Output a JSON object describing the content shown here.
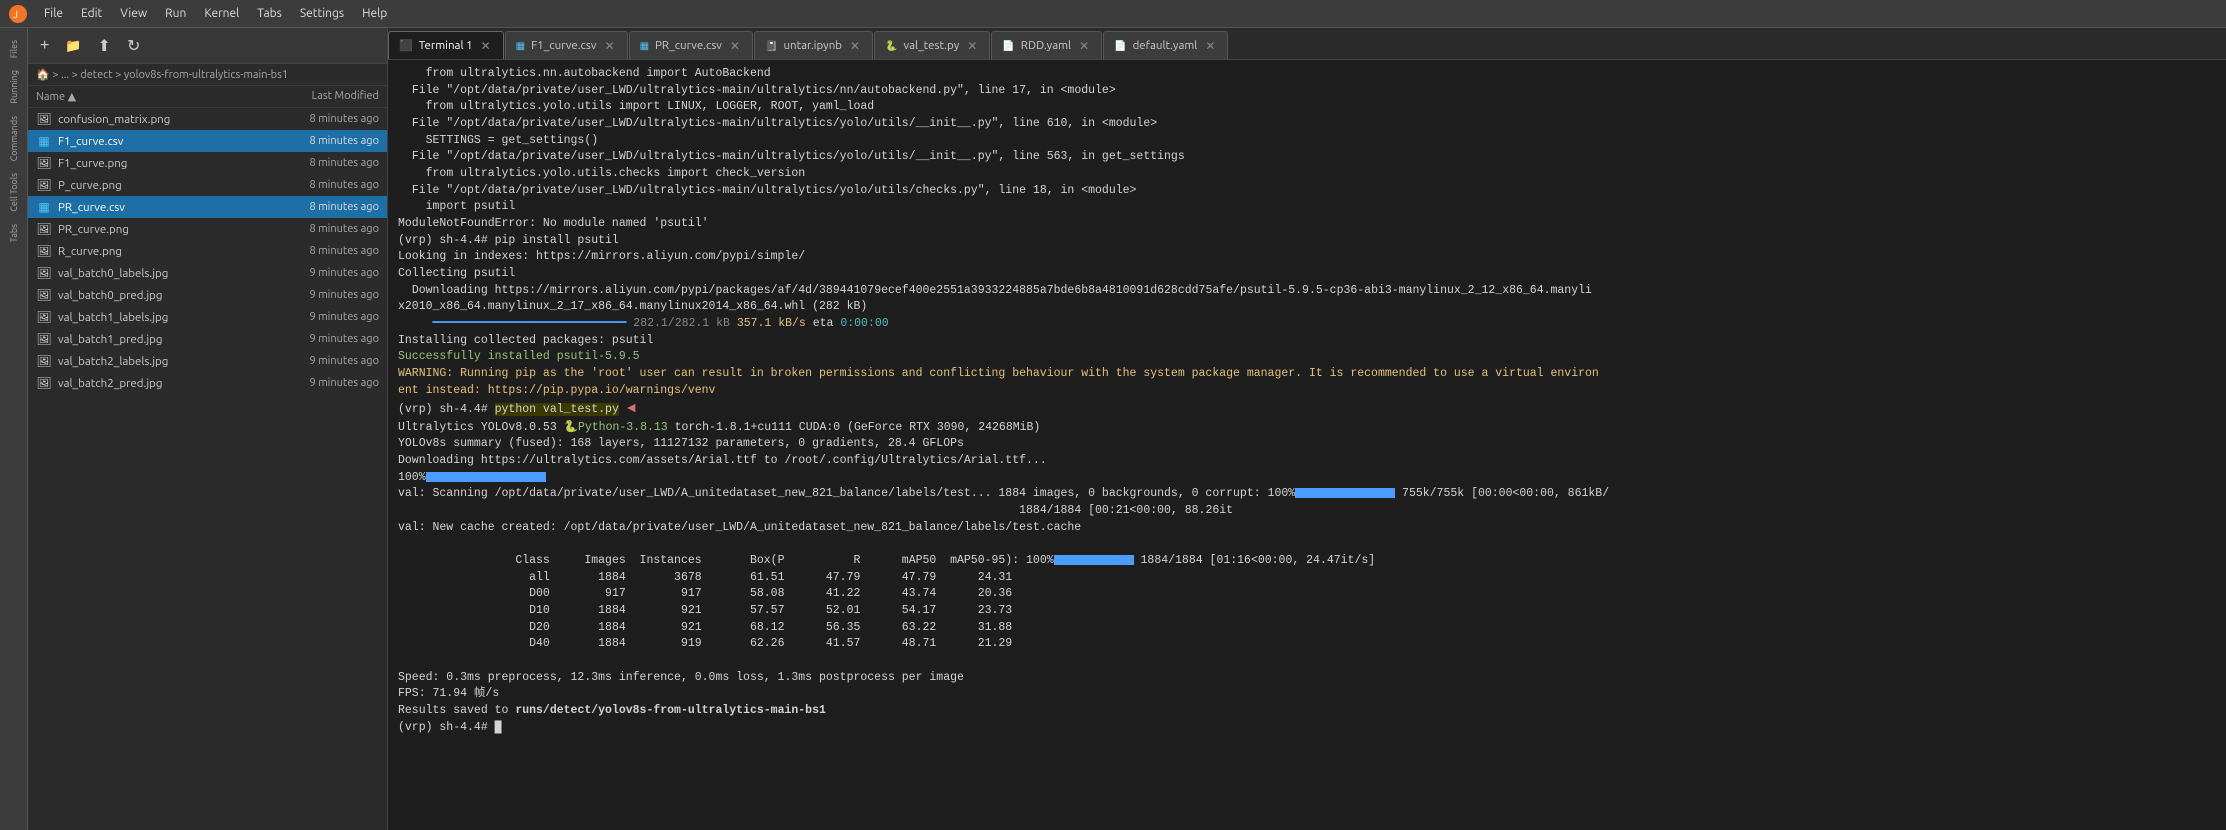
{
  "menubar": {
    "items": [
      "File",
      "Edit",
      "View",
      "Run",
      "Kernel",
      "Tabs",
      "Settings",
      "Help"
    ]
  },
  "sidebar": {
    "labels": [
      "Files",
      "Running",
      "Commands",
      "Cell Tools",
      "Tabs"
    ]
  },
  "filepanel": {
    "toolbar": {
      "new_label": "+",
      "folder_label": "📁",
      "upload_label": "⬆",
      "refresh_label": "↻"
    },
    "breadcrumb": "🏠 > ... > detect > yolov8s-from-ultralytics-main-bs1",
    "columns": {
      "name": "Name",
      "modified": "Last Modified"
    },
    "files": [
      {
        "name": "confusion_matrix.png",
        "modified": "8 minutes ago",
        "type": "image",
        "selected": false
      },
      {
        "name": "F1_curve.csv",
        "modified": "8 minutes ago",
        "type": "csv",
        "selected": true
      },
      {
        "name": "F1_curve.png",
        "modified": "8 minutes ago",
        "type": "image",
        "selected": false
      },
      {
        "name": "P_curve.png",
        "modified": "8 minutes ago",
        "type": "image",
        "selected": false
      },
      {
        "name": "PR_curve.csv",
        "modified": "8 minutes ago",
        "type": "csv",
        "selected": true
      },
      {
        "name": "PR_curve.png",
        "modified": "8 minutes ago",
        "type": "image",
        "selected": false
      },
      {
        "name": "R_curve.png",
        "modified": "8 minutes ago",
        "type": "image",
        "selected": false
      },
      {
        "name": "val_batch0_labels.jpg",
        "modified": "9 minutes ago",
        "type": "image",
        "selected": false
      },
      {
        "name": "val_batch0_pred.jpg",
        "modified": "9 minutes ago",
        "type": "image",
        "selected": false
      },
      {
        "name": "val_batch1_labels.jpg",
        "modified": "9 minutes ago",
        "type": "image",
        "selected": false
      },
      {
        "name": "val_batch1_pred.jpg",
        "modified": "9 minutes ago",
        "type": "image",
        "selected": false
      },
      {
        "name": "val_batch2_labels.jpg",
        "modified": "9 minutes ago",
        "type": "image",
        "selected": false
      },
      {
        "name": "val_batch2_pred.jpg",
        "modified": "9 minutes ago",
        "type": "image",
        "selected": false
      }
    ]
  },
  "tabs": [
    {
      "label": "Terminal 1",
      "type": "terminal",
      "active": true
    },
    {
      "label": "F1_curve.csv",
      "type": "csv",
      "active": false
    },
    {
      "label": "PR_curve.csv",
      "type": "csv",
      "active": false
    },
    {
      "label": "untar.ipynb",
      "type": "notebook",
      "active": false
    },
    {
      "label": "val_test.py",
      "type": "python",
      "active": false
    },
    {
      "label": "RDD.yaml",
      "type": "yaml",
      "active": false
    },
    {
      "label": "default.yaml",
      "type": "yaml",
      "active": false
    }
  ],
  "terminal": {
    "content": "terminal output"
  }
}
